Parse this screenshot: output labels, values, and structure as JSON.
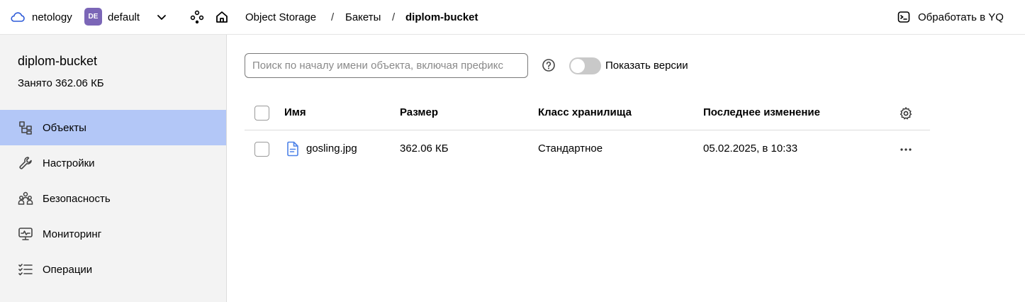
{
  "topbar": {
    "cloud": "netology",
    "folder_badge": "DE",
    "folder": "default",
    "breadcrumbs": [
      "Object Storage",
      "Бакеты",
      "diplom-bucket"
    ],
    "separator": "/",
    "yq_label": "Обработать в YQ"
  },
  "sidebar": {
    "bucket_name": "diplom-bucket",
    "usage": "Занято 362.06 КБ",
    "items": [
      {
        "label": "Объекты",
        "icon": "objects-icon",
        "active": true
      },
      {
        "label": "Настройки",
        "icon": "wrench-icon",
        "active": false
      },
      {
        "label": "Безопасность",
        "icon": "users-icon",
        "active": false
      },
      {
        "label": "Мониторинг",
        "icon": "monitor-icon",
        "active": false
      },
      {
        "label": "Операции",
        "icon": "list-check-icon",
        "active": false
      }
    ]
  },
  "main": {
    "search_placeholder": "Поиск по началу имени объекта, включая префикс",
    "show_versions_label": "Показать версии",
    "show_versions_on": false,
    "columns": [
      "Имя",
      "Размер",
      "Класс хранилища",
      "Последнее изменение"
    ],
    "rows": [
      {
        "name": "gosling.jpg",
        "size": "362.06 КБ",
        "storage_class": "Стандартное",
        "modified": "05.02.2025, в 10:33"
      }
    ]
  },
  "colors": {
    "active_nav": "#b3c7f7",
    "folder_badge": "#7b66b7",
    "file_icon": "#4d82e8",
    "sidebar_bg": "#f3f3f3"
  }
}
